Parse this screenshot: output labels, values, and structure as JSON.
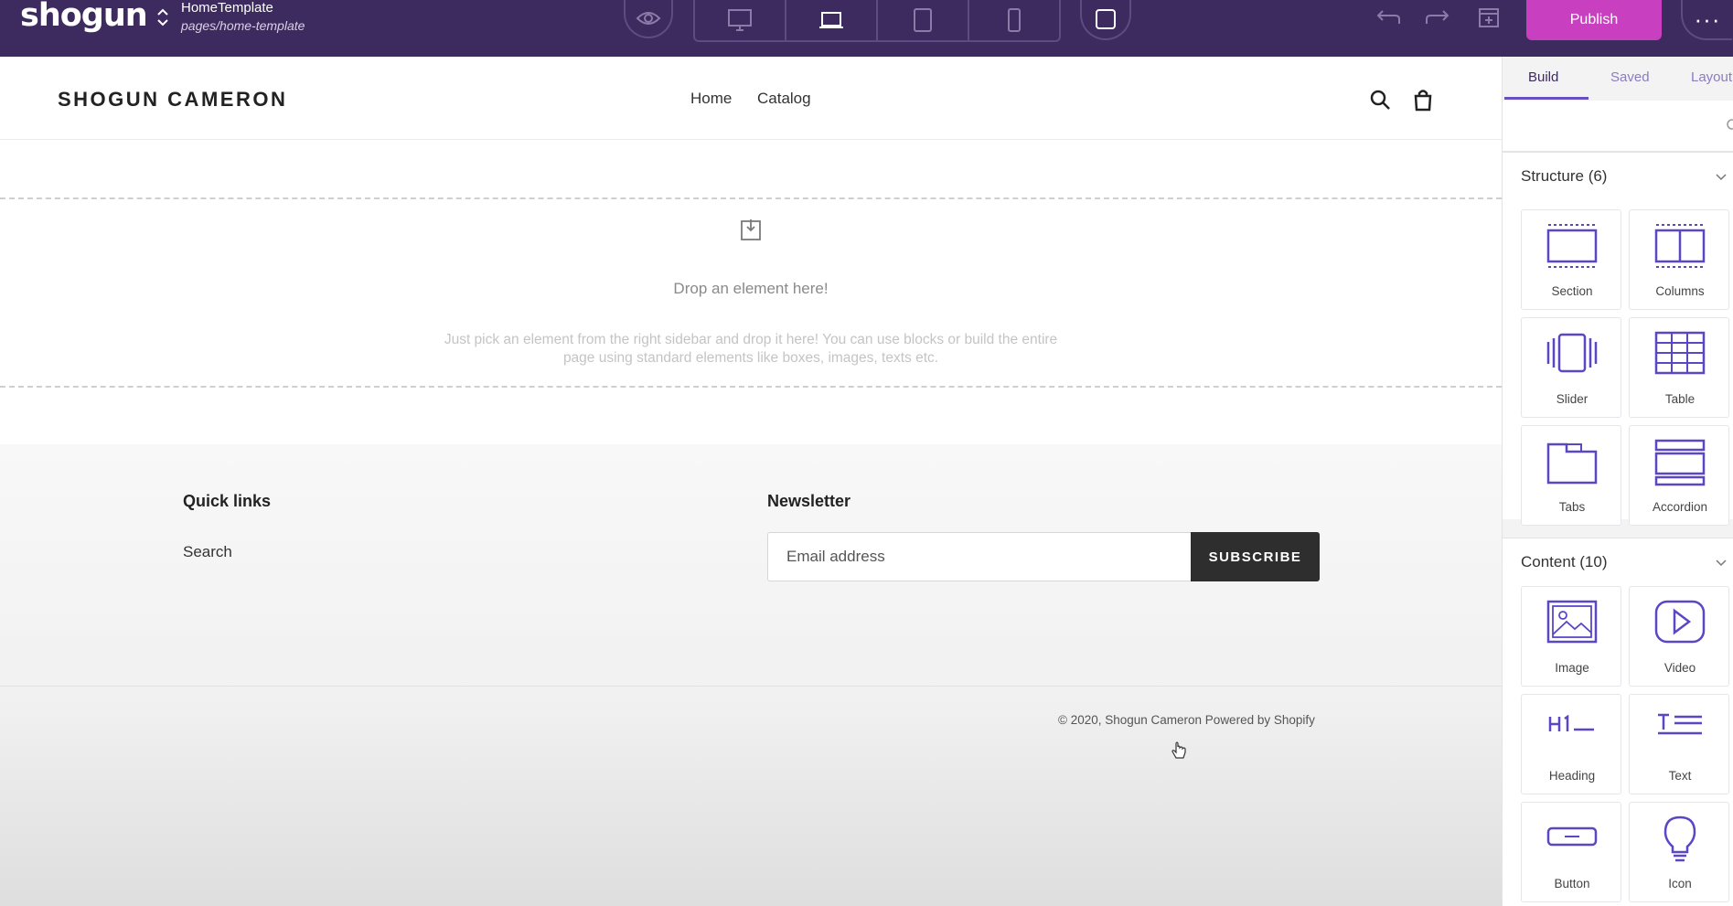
{
  "topbar": {
    "logo": "shogun",
    "template_name": "HomeTemplate",
    "template_path": "pages/home-template",
    "publish_label": "Publish",
    "more_label": "···",
    "accent": "#3d2a5e",
    "publish_color": "#c83fbf"
  },
  "store": {
    "title": "SHOGUN CAMERON",
    "nav": [
      "Home",
      "Catalog"
    ]
  },
  "dropzone": {
    "title": "Drop an element here!",
    "description": "Just pick an element from the right sidebar and drop it here! You can use blocks or build the entire page using standard elements like boxes, images, texts etc."
  },
  "footer": {
    "quick_links_title": "Quick links",
    "quick_links": [
      "Search"
    ],
    "newsletter_title": "Newsletter",
    "email_placeholder": "Email address",
    "subscribe_label": "SUBSCRIBE",
    "copyright": "© 2020, Shogun Cameron Powered by Shopify"
  },
  "sidebar": {
    "tabs": [
      "Build",
      "Saved",
      "Layout"
    ],
    "structure": {
      "title": "Structure (6)",
      "items": [
        "Section",
        "Columns",
        "Slider",
        "Table",
        "Tabs",
        "Accordion"
      ]
    },
    "content": {
      "title": "Content (10)",
      "items": [
        "Image",
        "Video",
        "Heading",
        "Text",
        "Button",
        "Icon"
      ]
    }
  }
}
